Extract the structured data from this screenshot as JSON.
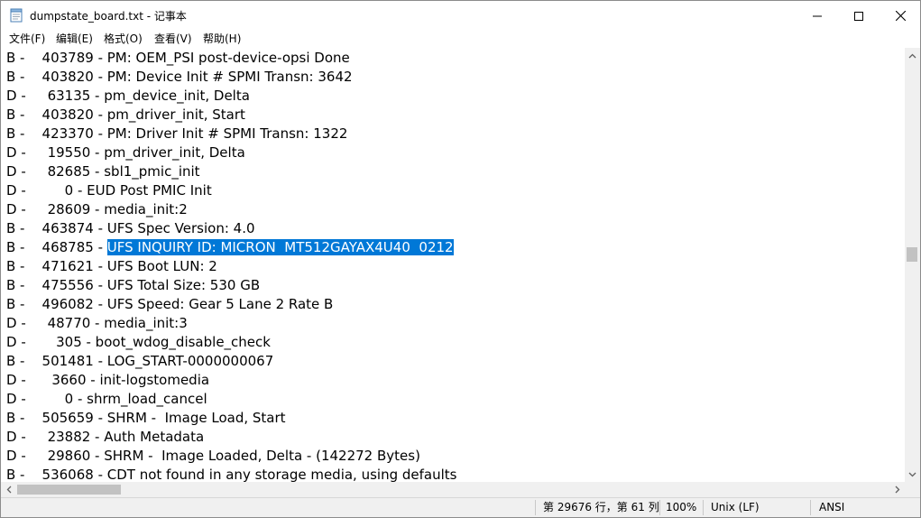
{
  "window": {
    "title": "dumpstate_board.txt - 记事本",
    "icon": "notepad-icon",
    "controls": {
      "minimize": "minimize-icon",
      "maximize": "maximize-icon",
      "close": "close-icon"
    }
  },
  "menu": [
    {
      "label": "文件(F)"
    },
    {
      "label": "编辑(E)"
    },
    {
      "label": "格式(O)"
    },
    {
      "label": "查看(V)"
    },
    {
      "label": "帮助(H)"
    }
  ],
  "editor": {
    "lines": [
      {
        "text": "B -    403789 - PM: OEM_PSI post-device-opsi Done"
      },
      {
        "text": "B -    403820 - PM: Device Init # SPMI Transn: 3642"
      },
      {
        "text": "D -     63135 - pm_device_init, Delta"
      },
      {
        "text": "B -    403820 - pm_driver_init, Start"
      },
      {
        "text": "B -    423370 - PM: Driver Init # SPMI Transn: 1322"
      },
      {
        "text": "D -     19550 - pm_driver_init, Delta"
      },
      {
        "text": "D -     82685 - sbl1_pmic_init"
      },
      {
        "text": "D -         0 - EUD Post PMIC Init"
      },
      {
        "text": "D -     28609 - media_init:2"
      },
      {
        "text": "B -    463874 - UFS Spec Version: 4.0"
      },
      {
        "prefix": "B -    468785 - ",
        "selected": "UFS INQUIRY ID: MICRON  MT512GAYAX4U40  0212"
      },
      {
        "text": "B -    471621 - UFS Boot LUN: 2"
      },
      {
        "text": "B -    475556 - UFS Total Size: 530 GB"
      },
      {
        "text": "B -    496082 - UFS Speed: Gear 5 Lane 2 Rate B"
      },
      {
        "text": "D -     48770 - media_init:3"
      },
      {
        "text": "D -       305 - boot_wdog_disable_check"
      },
      {
        "text": "B -    501481 - LOG_START-0000000067"
      },
      {
        "text": "D -      3660 - init-logstomedia"
      },
      {
        "text": "D -         0 - shrm_load_cancel"
      },
      {
        "text": "B -    505659 - SHRM -  Image Load, Start"
      },
      {
        "text": "D -     23882 - Auth Metadata"
      },
      {
        "text": "D -     29860 - SHRM -  Image Loaded, Delta - (142272 Bytes)"
      },
      {
        "text": "B -    536068 - CDT not found in any storage media, using defaults"
      }
    ]
  },
  "statusbar": {
    "position": "第 29676 行，第 61 列",
    "zoom": "100%",
    "line_ending": "Unix (LF)",
    "encoding": "ANSI"
  },
  "colors": {
    "selection": "#0078d7",
    "selection_text": "#ffffff",
    "statusbar_bg": "#f0f0f0"
  }
}
